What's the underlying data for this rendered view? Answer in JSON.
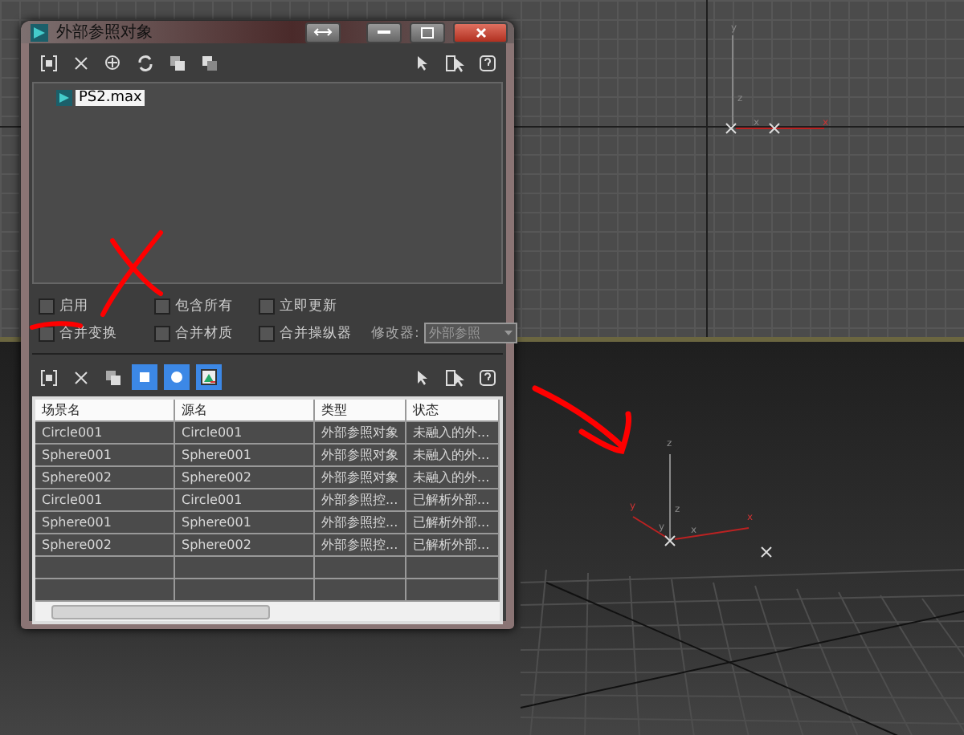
{
  "window": {
    "title": "外部参照对象"
  },
  "top_toolbar": [
    {
      "kind": "frame"
    },
    {
      "kind": "delete"
    },
    {
      "kind": "add"
    },
    {
      "kind": "refresh"
    },
    {
      "kind": "copy"
    },
    {
      "kind": "paste"
    },
    {
      "kind": "spacer"
    },
    {
      "kind": "pointer"
    },
    {
      "kind": "select"
    },
    {
      "kind": "help"
    }
  ],
  "tree": {
    "items": [
      {
        "label": "PS2.max",
        "selected": true
      }
    ]
  },
  "options": [
    {
      "label": "启用",
      "checked": false
    },
    {
      "label": "包含所有",
      "checked": false
    },
    {
      "label": "立即更新",
      "checked": false
    },
    {
      "label": "合并变换",
      "checked": false
    },
    {
      "label": "合并材质",
      "checked": false
    },
    {
      "label": "合并操纵器",
      "checked": false
    }
  ],
  "modifier": {
    "label": "修改器:",
    "value": "外部参照",
    "disabled": true
  },
  "record_toolbar": [
    {
      "kind": "frame"
    },
    {
      "kind": "delete"
    },
    {
      "kind": "copy"
    },
    {
      "kind": "cube",
      "on": true
    },
    {
      "kind": "sphere",
      "on": true
    },
    {
      "kind": "image",
      "on": true
    },
    {
      "kind": "spacer"
    },
    {
      "kind": "pointer"
    },
    {
      "kind": "select"
    },
    {
      "kind": "help"
    }
  ],
  "table": {
    "columns": [
      "场景名",
      "源名",
      "类型",
      "状态"
    ],
    "rows": [
      [
        "Circle001",
        "Circle001",
        "外部参照对象",
        "未融入的外..."
      ],
      [
        "Sphere001",
        "Sphere001",
        "外部参照对象",
        "未融入的外..."
      ],
      [
        "Sphere002",
        "Sphere002",
        "外部参照对象",
        "未融入的外..."
      ],
      [
        "Circle001",
        "Circle001",
        "外部参照控...",
        "已解析外部..."
      ],
      [
        "Sphere001",
        "Sphere001",
        "外部参照控...",
        "已解析外部..."
      ],
      [
        "Sphere002",
        "Sphere002",
        "外部参照控...",
        "已解析外部..."
      ]
    ]
  },
  "viewport_top": {
    "axis_labels": [
      "y",
      "z",
      "x",
      "x"
    ]
  },
  "viewport_perspective": {
    "axis_labels": [
      "z",
      "z",
      "y",
      "y",
      "x",
      "x"
    ]
  }
}
